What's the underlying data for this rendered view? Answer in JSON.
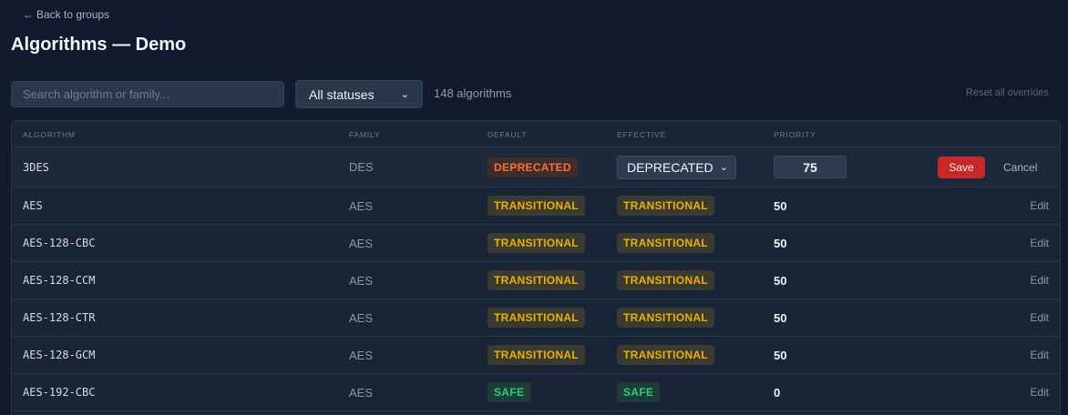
{
  "nav": {
    "back_label": "Back to groups",
    "back_icon": "arrow-left-icon"
  },
  "page": {
    "title": "Algorithms — Demo"
  },
  "toolbar": {
    "search_placeholder": "Search algorithm or family...",
    "status_filter": "All statuses",
    "count_label": "148 algorithms",
    "reset_label": "Reset all overrides"
  },
  "table": {
    "headers": {
      "algorithm": "ALGORITHM",
      "family": "FAMILY",
      "default": "DEFAULT",
      "effective": "EFFECTIVE",
      "priority": "PRIORITY"
    },
    "editing_row": {
      "algorithm": "3DES",
      "family": "DES",
      "default": "DEPRECATED",
      "effective_select": "DEPRECATED",
      "priority_value": "75",
      "save_label": "Save",
      "cancel_label": "Cancel"
    },
    "rows": [
      {
        "algorithm": "AES",
        "family": "AES",
        "default": "TRANSITIONAL",
        "effective": "TRANSITIONAL",
        "priority": "50",
        "action": "Edit"
      },
      {
        "algorithm": "AES-128-CBC",
        "family": "AES",
        "default": "TRANSITIONAL",
        "effective": "TRANSITIONAL",
        "priority": "50",
        "action": "Edit"
      },
      {
        "algorithm": "AES-128-CCM",
        "family": "AES",
        "default": "TRANSITIONAL",
        "effective": "TRANSITIONAL",
        "priority": "50",
        "action": "Edit"
      },
      {
        "algorithm": "AES-128-CTR",
        "family": "AES",
        "default": "TRANSITIONAL",
        "effective": "TRANSITIONAL",
        "priority": "50",
        "action": "Edit"
      },
      {
        "algorithm": "AES-128-GCM",
        "family": "AES",
        "default": "TRANSITIONAL",
        "effective": "TRANSITIONAL",
        "priority": "50",
        "action": "Edit"
      },
      {
        "algorithm": "AES-192-CBC",
        "family": "AES",
        "default": "SAFE",
        "effective": "SAFE",
        "priority": "0",
        "action": "Edit"
      }
    ]
  },
  "colors": {
    "background": "#111a2d",
    "transitional": "#eab10a",
    "deprecated": "#f2713b",
    "safe": "#2fc98a",
    "save": "#c62828"
  }
}
